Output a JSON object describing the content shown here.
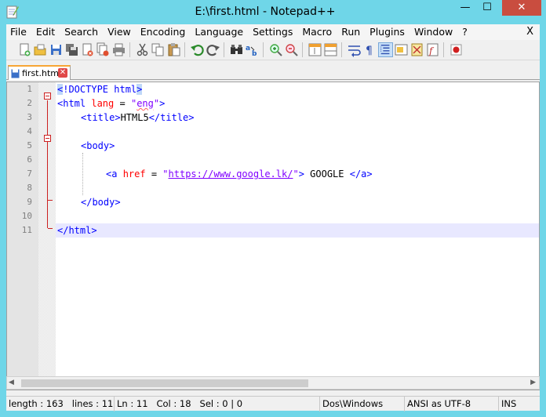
{
  "window": {
    "title": "E:\\first.html - Notepad++",
    "minimize_glyph": "—",
    "maximize_glyph": "☐",
    "close_glyph": "✕"
  },
  "menu": {
    "items": [
      "File",
      "Edit",
      "Search",
      "View",
      "Encoding",
      "Language",
      "Settings",
      "Macro",
      "Run",
      "Plugins",
      "Window",
      "?"
    ],
    "close_glyph": "X"
  },
  "toolbar": {
    "icons": [
      "new-file-icon",
      "open-file-icon",
      "save-icon",
      "save-all-icon",
      "close-icon",
      "close-all-icon",
      "print-icon",
      "cut-icon",
      "copy-icon",
      "paste-icon",
      "undo-icon",
      "redo-icon",
      "find-icon",
      "replace-icon",
      "zoom-in-icon",
      "zoom-out-icon",
      "sync-vertical-icon",
      "sync-horizontal-icon",
      "word-wrap-icon",
      "show-all-chars-icon",
      "indent-guide-icon",
      "user-language-icon",
      "doc-map-icon",
      "function-list-icon",
      "record-macro-icon"
    ]
  },
  "tabs": [
    {
      "label": "first.html",
      "close_glyph": "✕"
    }
  ],
  "editor": {
    "line_numbers": [
      "1",
      "2",
      "3",
      "4",
      "5",
      "6",
      "7",
      "8",
      "9",
      "10",
      "11"
    ],
    "current_line": 11,
    "lines": {
      "l1": {
        "hl_open": "<",
        "rest": "!DOCTYPE html",
        "hl_close": ">"
      },
      "l2": {
        "open": "<html ",
        "attr": "lang",
        "eq": " = ",
        "q1": "\"",
        "val": "eng",
        "q2": "\"",
        "close": ">"
      },
      "l3": {
        "open": "<title>",
        "text": "HTML5",
        "close": "</title>"
      },
      "l5": {
        "tag": "<body>"
      },
      "l7": {
        "open": "<a ",
        "attr": "href",
        "eq": " = ",
        "q1": "\"",
        "url": "https://www.google.lk/",
        "q2": "\"",
        "close": ">",
        "text": " GOOGLE ",
        "end": "</a>"
      },
      "l9": {
        "tag": "</body>"
      },
      "l11": {
        "tag": "</html>"
      }
    }
  },
  "scrollbar": {
    "left_arrow": "◀",
    "right_arrow": "▶"
  },
  "status": {
    "length": "length : 163",
    "lines": "lines : 11",
    "ln": "Ln : 11",
    "col": "Col : 18",
    "sel": "Sel : 0 | 0",
    "eol": "Dos\\Windows",
    "encoding": "ANSI as UTF-8",
    "mode": "INS"
  }
}
